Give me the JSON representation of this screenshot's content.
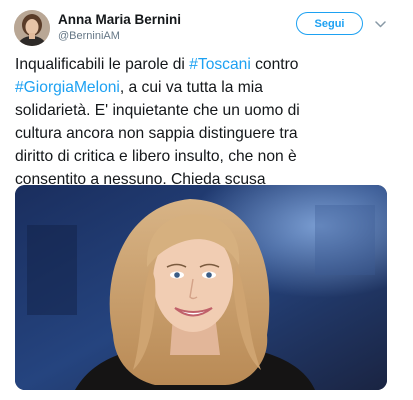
{
  "author": {
    "display_name": "Anna Maria Bernini",
    "handle": "@BerniniAM"
  },
  "follow_label": "Segui",
  "tweet": {
    "lines": [
      [
        {
          "t": "Inqualificabili le parole di "
        },
        {
          "t": "#Toscani",
          "tag": true
        },
        {
          "t": " contro"
        }
      ],
      [
        {
          "t": "#GiorgiaMeloni",
          "tag": true
        },
        {
          "t": ", a cui va tutta la mia"
        }
      ],
      [
        {
          "t": "solidarietà. E' inquietante che un uomo di"
        }
      ],
      [
        {
          "t": "cultura ancora non sappia distinguere tra"
        }
      ],
      [
        {
          "t": "diritto di critica e libero insulto, che non è"
        }
      ],
      [
        {
          "t": "consentito a nessuno. Chieda scusa"
        }
      ]
    ]
  },
  "colors": {
    "link": "#1da1f2",
    "text": "#14171a",
    "secondary": "#657786"
  },
  "icons": {
    "more": "chevron-down-icon"
  }
}
